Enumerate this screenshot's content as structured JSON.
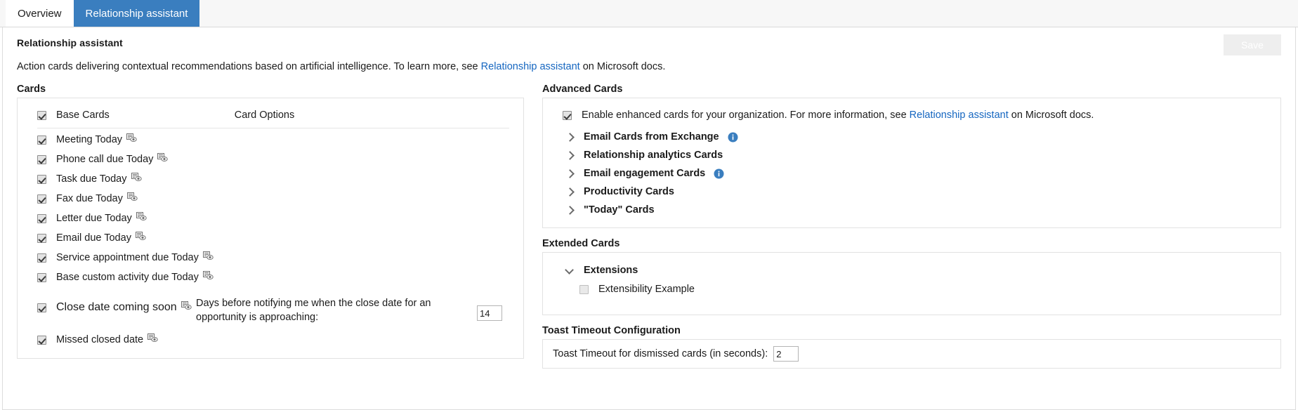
{
  "tabs": [
    {
      "label": "Overview",
      "active": false
    },
    {
      "label": "Relationship assistant",
      "active": true
    }
  ],
  "header": {
    "title": "Relationship assistant",
    "description_before": "Action cards delivering contextual recommendations based on artificial intelligence. To learn more, see ",
    "description_link": "Relationship assistant",
    "description_after": " on Microsoft docs.",
    "save_label": "Save"
  },
  "cards_section": {
    "label": "Cards",
    "header_row": {
      "base_cards_label": "Base Cards",
      "card_options_label": "Card Options",
      "checked": true
    },
    "items": [
      {
        "label": "Meeting Today",
        "checked": true,
        "preview": true
      },
      {
        "label": "Phone call due Today",
        "checked": true,
        "preview": true
      },
      {
        "label": "Task due Today",
        "checked": true,
        "preview": true
      },
      {
        "label": "Fax due Today",
        "checked": true,
        "preview": true
      },
      {
        "label": "Letter due Today",
        "checked": true,
        "preview": true
      },
      {
        "label": "Email due Today",
        "checked": true,
        "preview": true
      },
      {
        "label": "Service appointment due Today",
        "checked": true,
        "preview": true
      },
      {
        "label": "Base custom activity due Today",
        "checked": true,
        "preview": true
      }
    ],
    "close_date_row": {
      "label": "Close date coming soon",
      "checked": true,
      "option_text": "Days before notifying me when the close date for an opportunity is approaching:",
      "value": "14"
    },
    "missed_row": {
      "label": "Missed closed date",
      "checked": true,
      "preview": true
    }
  },
  "advanced_cards": {
    "label": "Advanced Cards",
    "enable": {
      "checked": true,
      "text_before": "Enable enhanced cards for your organization. For more information, see ",
      "link": "Relationship assistant",
      "text_after": " on Microsoft docs."
    },
    "groups": [
      {
        "label": "Email Cards from Exchange",
        "expanded": false,
        "info": true
      },
      {
        "label": "Relationship analytics Cards",
        "expanded": false,
        "info": false
      },
      {
        "label": "Email engagement Cards",
        "expanded": false,
        "info": true
      },
      {
        "label": "Productivity Cards",
        "expanded": false,
        "info": false
      },
      {
        "label": "\"Today\" Cards",
        "expanded": false,
        "info": false
      }
    ]
  },
  "extended_cards": {
    "label": "Extended Cards",
    "group": {
      "label": "Extensions",
      "expanded": true
    },
    "children": [
      {
        "label": "Extensibility Example",
        "checked": false
      }
    ]
  },
  "toast": {
    "label": "Toast Timeout Configuration",
    "field_label": "Toast Timeout for dismissed cards (in seconds):",
    "value": "2"
  },
  "colors": {
    "tab_active": "#3a7ebf",
    "link": "#1566c0",
    "info_icon": "#3a7ebf",
    "border": "#e2e2e2"
  }
}
